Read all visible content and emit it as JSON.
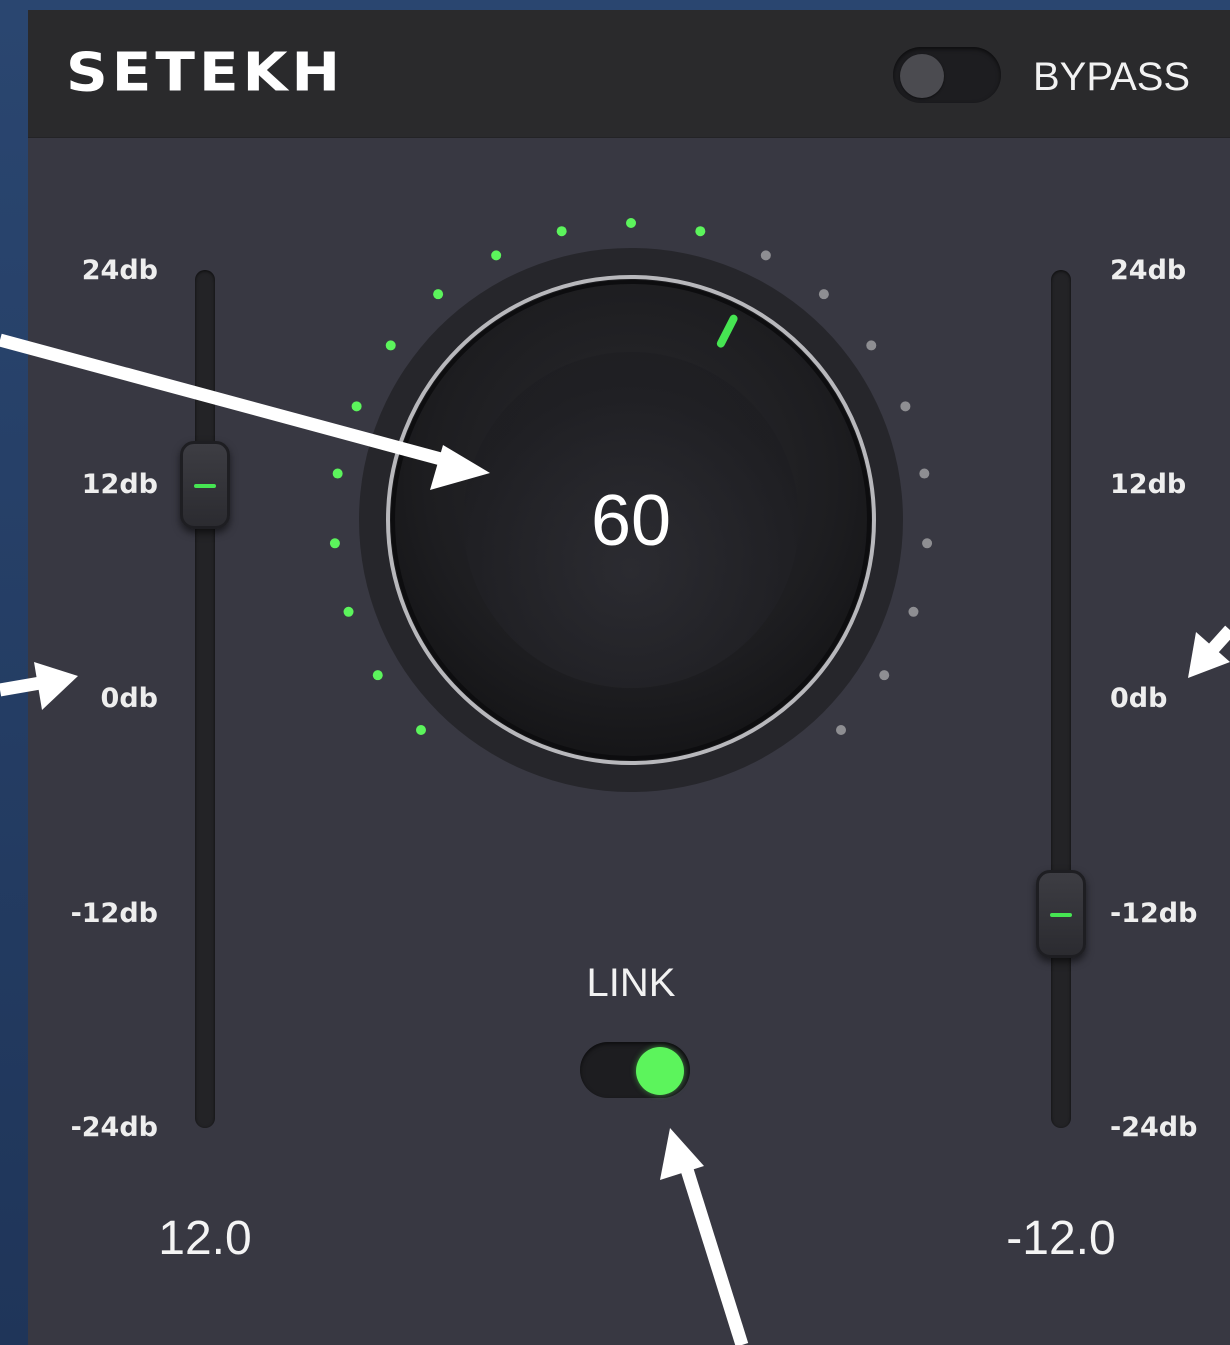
{
  "header": {
    "brand": "SETEKH",
    "bypass_label": "BYPASS",
    "bypass_on": false
  },
  "left_slider": {
    "scale": [
      "24db",
      "12db",
      "0db",
      "-12db",
      "-24db"
    ],
    "value": 12.0,
    "value_text": "12.0"
  },
  "right_slider": {
    "scale": [
      "24db",
      "12db",
      "0db",
      "-12db",
      "-24db"
    ],
    "value": -12.0,
    "value_text": "-12.0"
  },
  "knob": {
    "value_text": "60",
    "value": 60,
    "max": 100,
    "ring_dot_count": 21,
    "lit_dot_count": 12
  },
  "link": {
    "label": "LINK",
    "on": true
  },
  "colors": {
    "accent": "#5cf45c",
    "panel": "#383842",
    "header": "#2a2a2c",
    "dot_off": "#8e8e92"
  }
}
